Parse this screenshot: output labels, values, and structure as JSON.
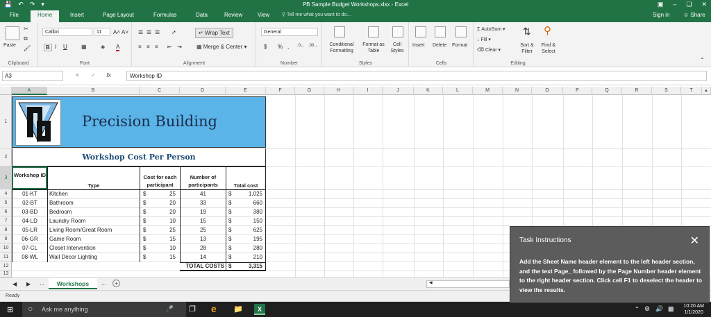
{
  "window": {
    "title": "PB Sample Budget Workshops.xlsx - Excel"
  },
  "tabs": [
    "File",
    "Home",
    "Insert",
    "Page Layout",
    "Formulas",
    "Data",
    "Review",
    "View"
  ],
  "tell_me": "Tell me what you want to do...",
  "account": {
    "signin": "Sign in",
    "share": "Share"
  },
  "ribbon": {
    "clipboard": {
      "paste": "Paste",
      "label": "Clipboard"
    },
    "font": {
      "name": "Calibri",
      "size": "11",
      "label": "Font",
      "bold": "B",
      "italic": "I",
      "underline": "U"
    },
    "alignment": {
      "wrap": "Wrap Text",
      "merge": "Merge & Center",
      "label": "Alignment"
    },
    "number": {
      "format": "General",
      "currency": "$",
      "percent": "%",
      "comma": ",",
      "label": "Number"
    },
    "styles": {
      "conditional": "Conditional Formatting",
      "table": "Format as Table",
      "cell": "Cell Styles",
      "label": "Styles"
    },
    "cells": {
      "insert": "Insert",
      "delete": "Delete",
      "format": "Format",
      "label": "Cells"
    },
    "editing": {
      "autosum": "AutoSum",
      "fill": "Fill",
      "clear": "Clear",
      "sort": "Sort & Filter",
      "find": "Find & Select",
      "label": "Editing"
    }
  },
  "formula_bar": {
    "name_box": "A3",
    "fx": "fx",
    "value": "Workshop ID"
  },
  "columns": [
    "A",
    "B",
    "C",
    "D",
    "E",
    "F",
    "G",
    "H",
    "I",
    "J",
    "K",
    "L",
    "M",
    "N",
    "O",
    "P",
    "Q",
    "R",
    "S",
    "T"
  ],
  "rows": [
    "1",
    "2",
    "3",
    "4",
    "5",
    "6",
    "7",
    "8",
    "9",
    "10",
    "11",
    "12",
    "13"
  ],
  "sheet": {
    "company": "Precision Building",
    "subtitle": "Workshop Cost Per Person",
    "headers": {
      "id": "Workshop ID",
      "type": "Type",
      "cost": "Cost for each participant",
      "num": "Number of participants",
      "total": "Total cost"
    },
    "data": [
      {
        "id": "01-KT",
        "type": "Kitchen",
        "cost": "25",
        "num": "41",
        "total": "1,025"
      },
      {
        "id": "02-BT",
        "type": "Bathroom",
        "cost": "20",
        "num": "33",
        "total": "660"
      },
      {
        "id": "03-BD",
        "type": "Bedroom",
        "cost": "20",
        "num": "19",
        "total": "380"
      },
      {
        "id": "04-LD",
        "type": "Laundry Room",
        "cost": "10",
        "num": "15",
        "total": "150"
      },
      {
        "id": "05-LR",
        "type": "Living Room/Great Room",
        "cost": "25",
        "num": "25",
        "total": "625"
      },
      {
        "id": "06-GR",
        "type": "Game Room",
        "cost": "15",
        "num": "13",
        "total": "195"
      },
      {
        "id": "07-CL",
        "type": "Closet Intervention",
        "cost": "10",
        "num": "28",
        "total": "280"
      },
      {
        "id": "08-WL",
        "type": "Wall Décor Lighting",
        "cost": "15",
        "num": "14",
        "total": "210"
      }
    ],
    "total_label": "TOTAL COSTS",
    "total_value": "3,315",
    "currency": "$"
  },
  "sheet_tab": "Workshops",
  "status": "Ready",
  "taskbar": {
    "search": "Ask me anything",
    "time": "10:20 AM",
    "date": "1/1/2020"
  },
  "task_panel": {
    "heading": "Task Instructions",
    "text": "Add the Sheet Name header element to the left header section, and the text  Page_  followed by the Page Number header element to the right header section. Click cell F1 to deselect the header to view the results."
  }
}
